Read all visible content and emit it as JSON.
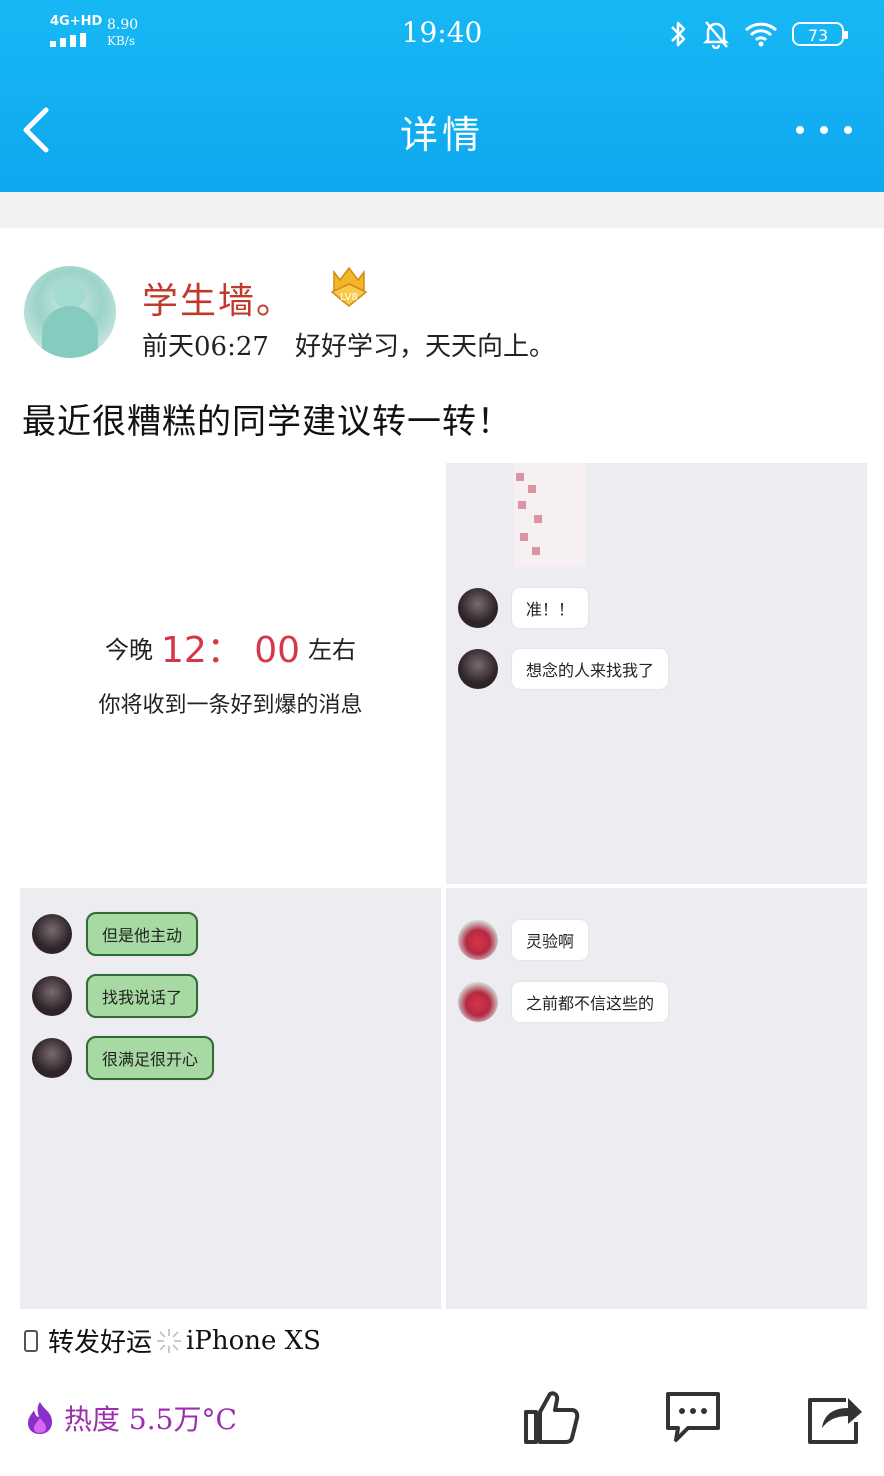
{
  "status_bar": {
    "network": "4G+HD",
    "speed_value": "8.90",
    "speed_unit": "KB/s",
    "time": "19:40",
    "battery": "73"
  },
  "nav": {
    "title": "详情"
  },
  "post": {
    "username": "学生墙。",
    "level_badge": "LV8",
    "time": "前天06:27",
    "signature": "好好学习，天天向上。",
    "text": "最近很糟糕的同学建议转一转！",
    "images": {
      "image1": {
        "line1_prefix": "今晚",
        "line1_time": "12： 00",
        "line1_suffix": "左右",
        "line2": "你将收到一条好到爆的消息"
      },
      "image2": {
        "messages": [
          "准！！",
          "想念的人来找我了"
        ]
      },
      "image3": {
        "messages": [
          "但是他主动",
          "找我说话了",
          "很满足很开心"
        ]
      },
      "image4": {
        "messages": [
          "灵验啊",
          "之前都不信这些的"
        ]
      }
    },
    "device": {
      "prefix": "转发好运",
      "model": "iPhone XS"
    },
    "heat": {
      "label": "热度",
      "value": "5.5万°C"
    }
  },
  "colors": {
    "header": "#0fa7ee",
    "username": "#c0392b",
    "heat": "#9b2fb0",
    "highlight_time": "#d6364a"
  }
}
